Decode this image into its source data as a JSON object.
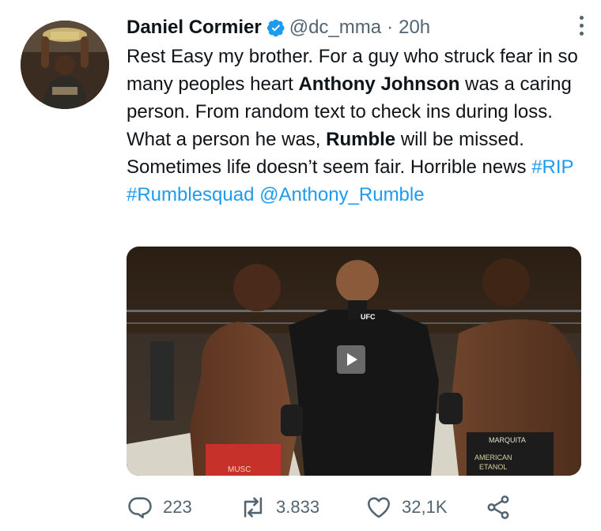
{
  "author": {
    "display_name": "Daniel Cormier",
    "handle": "@dc_mma",
    "separator": "·",
    "time": "20h",
    "verified": true
  },
  "tweet": {
    "segments": [
      {
        "text": "Rest Easy my brother. For a guy who struck fear in so many peoples heart ",
        "style": "plain"
      },
      {
        "text": "Anthony Johnson",
        "style": "bold"
      },
      {
        "text": " was a caring person. From random text to check ins during loss. What a person he was, ",
        "style": "plain"
      },
      {
        "text": "Rumble",
        "style": "bold"
      },
      {
        "text": " will be missed. Sometimes life doesn’t seem fair. Horrible news ",
        "style": "plain"
      },
      {
        "text": "#RIP",
        "style": "link"
      },
      {
        "text": " ",
        "style": "plain"
      },
      {
        "text": "#Rumblesquad",
        "style": "link"
      },
      {
        "text": " ",
        "style": "plain"
      },
      {
        "text": "@Anthony_Rumble",
        "style": "link"
      }
    ]
  },
  "media": {
    "type": "video",
    "overlay_text": [
      "UFC",
      "MARQUITA",
      "AMERICAN",
      "ETANOL",
      "MUSC"
    ]
  },
  "actions": {
    "reply_count": "223",
    "retweet_count": "3.833",
    "like_count": "32,1K"
  },
  "colors": {
    "link": "#1d9bf0",
    "muted": "#536471",
    "text": "#0f1419"
  },
  "icons": [
    "verified-icon",
    "more-icon",
    "play-icon",
    "reply-icon",
    "retweet-icon",
    "like-icon",
    "share-icon"
  ]
}
